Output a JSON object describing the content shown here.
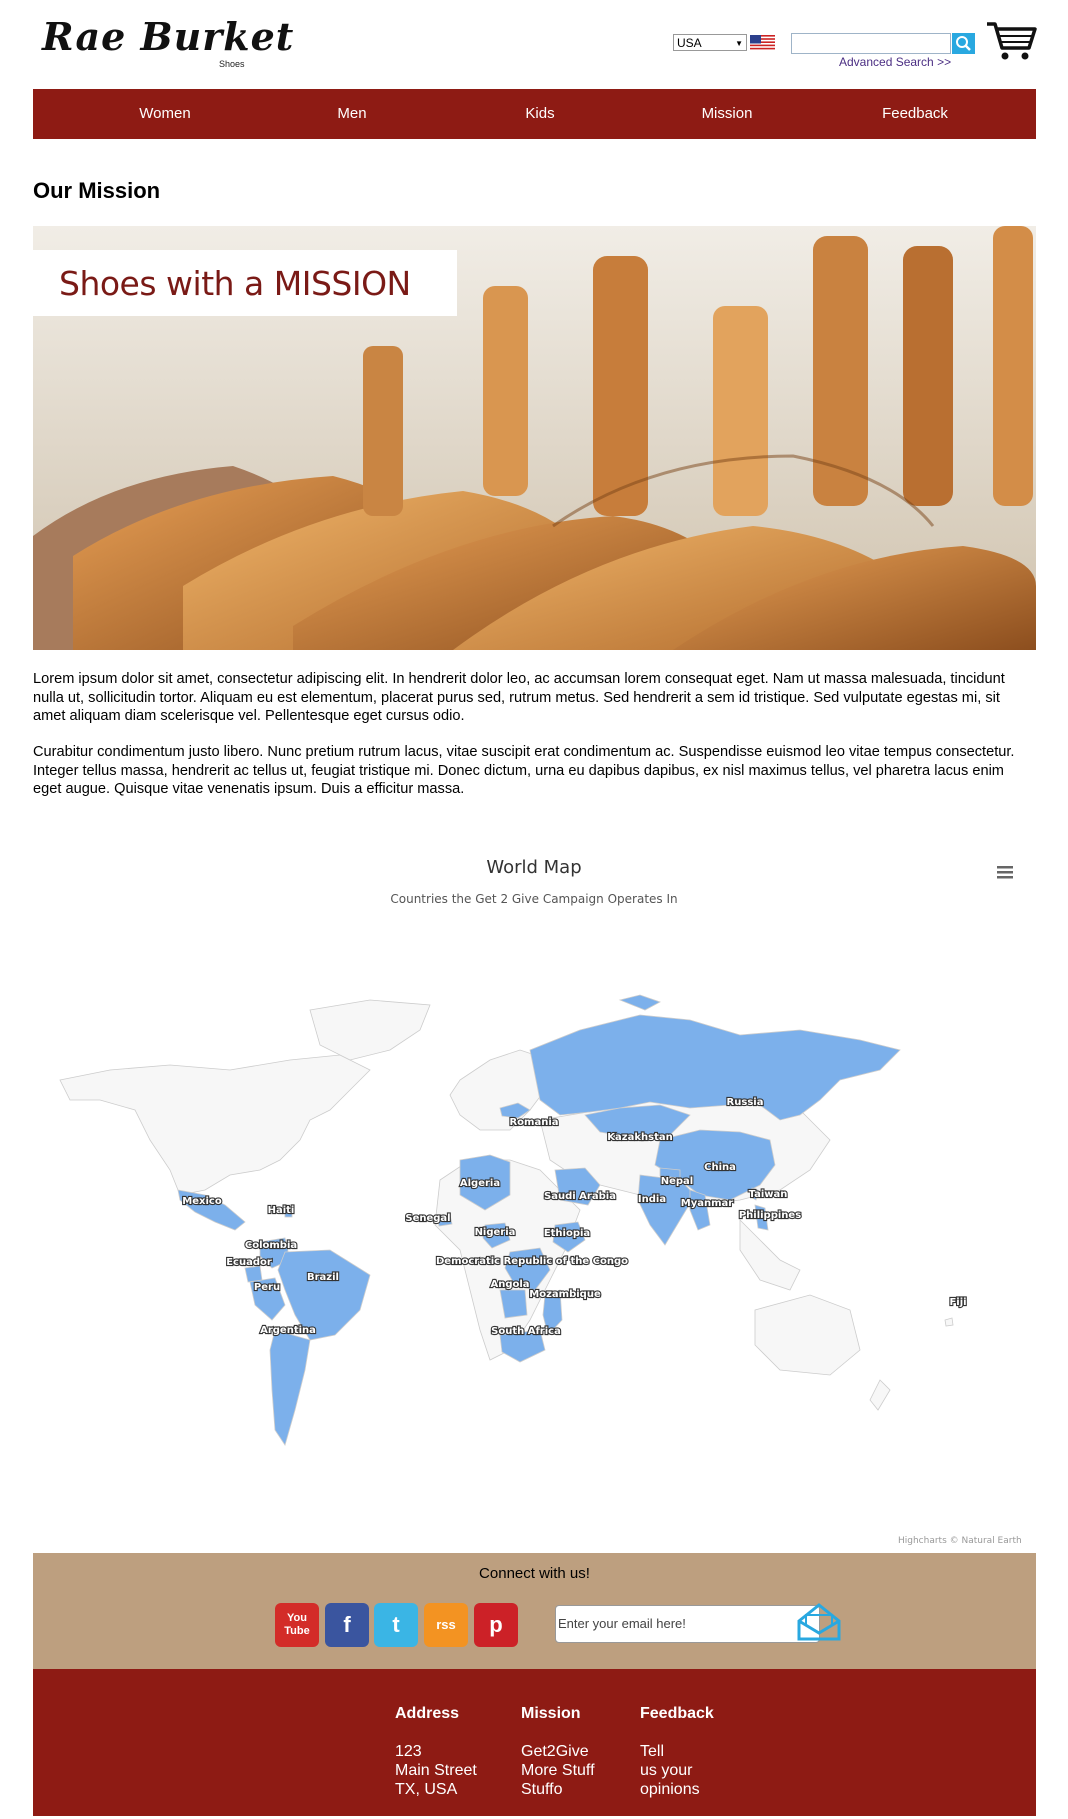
{
  "header": {
    "logo": "Rae Burket",
    "logo_sub": "Shoes",
    "country": "USA",
    "search_placeholder": "",
    "advanced_search": "Advanced Search >>"
  },
  "nav": {
    "items": [
      "Women",
      "Men",
      "Kids",
      "Mission",
      "Feedback"
    ]
  },
  "page": {
    "title": "Our Mission",
    "hero_text": "Shoes with a MISSION",
    "paragraph1": "Lorem ipsum dolor sit amet, consectetur adipiscing elit. In hendrerit dolor leo, ac accumsan lorem consequat eget. Nam ut massa malesuada, tincidunt nulla ut, sollicitudin tortor. Aliquam eu est elementum, placerat purus sed, rutrum metus. Sed hendrerit a sem id tristique. Sed vulputate egestas mi, sit amet aliquam diam scelerisque vel. Pellentesque eget cursus odio.",
    "paragraph2": "Curabitur condimentum justo libero. Nunc pretium rutrum lacus, vitae suscipit erat condimentum ac. Suspendisse euismod leo vitae tempus consectetur. Integer tellus massa, hendrerit ac tellus ut, feugiat tristique mi. Donec dictum, urna eu dapibus dapibus, ex nisl maximus tellus, vel pharetra lacus enim eget augue. Quisque vitae venenatis ipsum. Duis a efficitur massa."
  },
  "map": {
    "title": "World Map",
    "subtitle": "Countries the Get 2 Give Campaign Operates In",
    "credits": "Highcharts © Natural Earth",
    "highlight_color": "#7cb0eb",
    "base_color": "#f7f7f7",
    "countries": {
      "russia": "Russia",
      "kazakhstan": "Kazakhstan",
      "romania": "Romania",
      "china": "China",
      "nepal": "Nepal",
      "india": "India",
      "myanmar": "Myanmar",
      "taiwan": "Taiwan",
      "philippines": "Philippines",
      "algeria": "Algeria",
      "saudi": "Saudi Arabia",
      "senegal": "Senegal",
      "nigeria": "Nigeria",
      "ethiopia": "Ethiopia",
      "drc": "Democratic Republic of the Congo",
      "angola": "Angola",
      "mozambique": "Mozambique",
      "south_africa": "South Africa",
      "mexico": "Mexico",
      "haiti": "Haiti",
      "colombia": "Colombia",
      "ecuador": "Ecuador",
      "peru": "Peru",
      "brazil": "Brazil",
      "argentina": "Argentina",
      "fiji": "Fiji"
    }
  },
  "connect": {
    "title": "Connect with us!",
    "email_placeholder": "Enter your email here!",
    "social": [
      {
        "name": "youtube-icon",
        "label": "You Tube",
        "color": "#d32c28"
      },
      {
        "name": "facebook-icon",
        "label": "f",
        "color": "#3a559f"
      },
      {
        "name": "twitter-icon",
        "label": "t",
        "color": "#3ab5e5"
      },
      {
        "name": "rss-icon",
        "label": "rss",
        "color": "#f39322"
      },
      {
        "name": "pinterest-icon",
        "label": "p",
        "color": "#cc2127"
      }
    ]
  },
  "footer": {
    "address": {
      "heading": "Address",
      "lines": [
        "123",
        "Main Street",
        "TX, USA"
      ]
    },
    "mission": {
      "heading": "Mission",
      "lines": [
        "Get2Give",
        "More Stuff",
        "Stuffo"
      ]
    },
    "feedback": {
      "heading": "Feedback",
      "lines": [
        "Tell",
        "us your",
        "opinions"
      ]
    }
  },
  "colors": {
    "brand_red": "#8e1b14",
    "connect_tan": "#bd9f7f",
    "link_purple": "#4b2e83",
    "search_blue": "#29a8e0"
  }
}
